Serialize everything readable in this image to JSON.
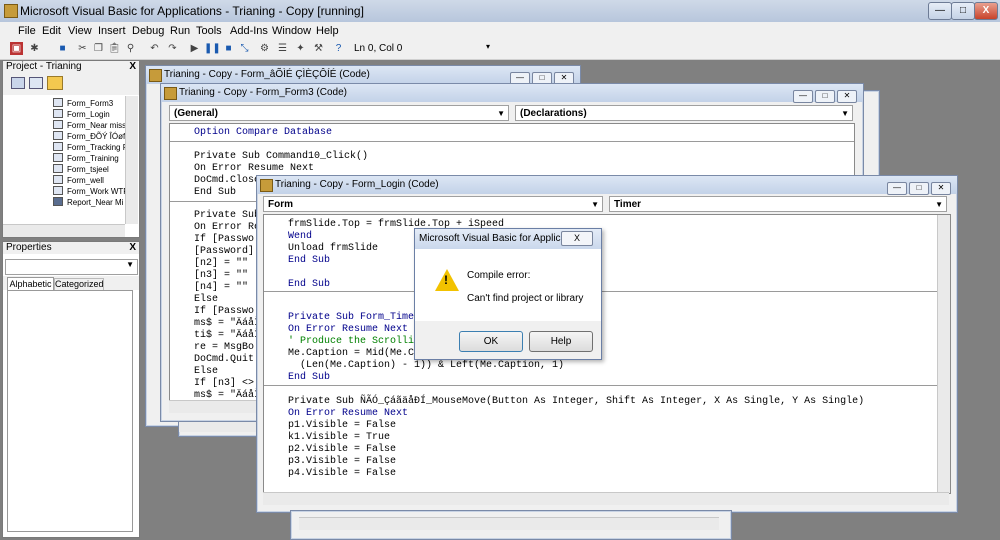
{
  "app": {
    "title": "Microsoft Visual Basic for Applications - Trianing - Copy [running]",
    "min": "—",
    "max": "□",
    "close": "X"
  },
  "menu": [
    "File",
    "Edit",
    "View",
    "Insert",
    "Debug",
    "Run",
    "Tools",
    "Add-Ins",
    "Window",
    "Help"
  ],
  "toolbar": {
    "position": "Ln 0, Col 0"
  },
  "project": {
    "title": "Project - Trianing",
    "close": "X",
    "items": [
      "Form_Form3",
      "Form_Login",
      "Form_Near miss",
      "Form_ÐÕÝ ÎÓøf",
      "Form_Tracking R",
      "Form_Training",
      "Form_tsjeel",
      "Form_well",
      "Form_Work WTF",
      "Report_Near Mi"
    ]
  },
  "properties": {
    "title": "Properties",
    "close": "X",
    "tab_alpha": "Alphabetic",
    "tab_cat": "Categorized"
  },
  "win_back": {
    "title": "Trianing - Copy - Form_âÕÌÉ ÇÌÈÇÔÍÉ (Code)"
  },
  "win_form3": {
    "title": "Trianing - Copy - Form_Form3 (Code)",
    "combo_left": "(General)",
    "combo_right": "(Declarations)",
    "lines": [
      "Option Compare Database",
      "",
      "Private Sub Command10_Click()",
      "On Error Resume Next",
      "DoCmd.Close",
      "End Sub",
      "",
      "Private Sub",
      "On Error Re",
      "If [Passwo",
      "[Password]",
      "[n2] = \"\"",
      "[n3] = \"\"",
      "[n4] = \"\"",
      "Else",
      "If [Passwo",
      "ms$ = \"ÄáåÌ",
      "ti$ = \"ÄáåÌ",
      "re = MsgBo",
      "DoCmd.Quit",
      "Else",
      "If [n3] <>",
      "ms$ = \"ÄáåÌ"
    ]
  },
  "win_login": {
    "title": "Trianing - Copy - Form_Login (Code)",
    "combo_left": "Form",
    "combo_right": "Timer",
    "lines_a": [
      "frmSlide.Top = frmSlide.Top + iSpeed",
      "Wend",
      "Unload frmSlide",
      "End Sub",
      "",
      "End Sub"
    ],
    "lines_b": [
      "Private Sub Form_Timer()",
      "On Error Resume Next",
      "' Produce the Scrolling",
      "Me.Caption = Mid(Me.Caption, 2,",
      "  (Len(Me.Caption) - 1)) & Left(Me.Caption, 1)",
      "End Sub"
    ],
    "lines_c": [
      "Private Sub ÑÃÓ_ÇáãäåÐÍ_MouseMove(Button As Integer, Shift As Integer, X As Single, Y As Single)",
      "On Error Resume Next",
      "p1.Visible = False",
      "k1.Visible = True",
      "p2.Visible = False",
      "p3.Visible = False",
      "p4.Visible = False"
    ]
  },
  "dialog": {
    "title": "Microsoft Visual Basic for Applicati...",
    "close": "X",
    "msg1": "Compile error:",
    "msg2": "Can't find project or library",
    "ok": "OK",
    "help": "Help"
  }
}
